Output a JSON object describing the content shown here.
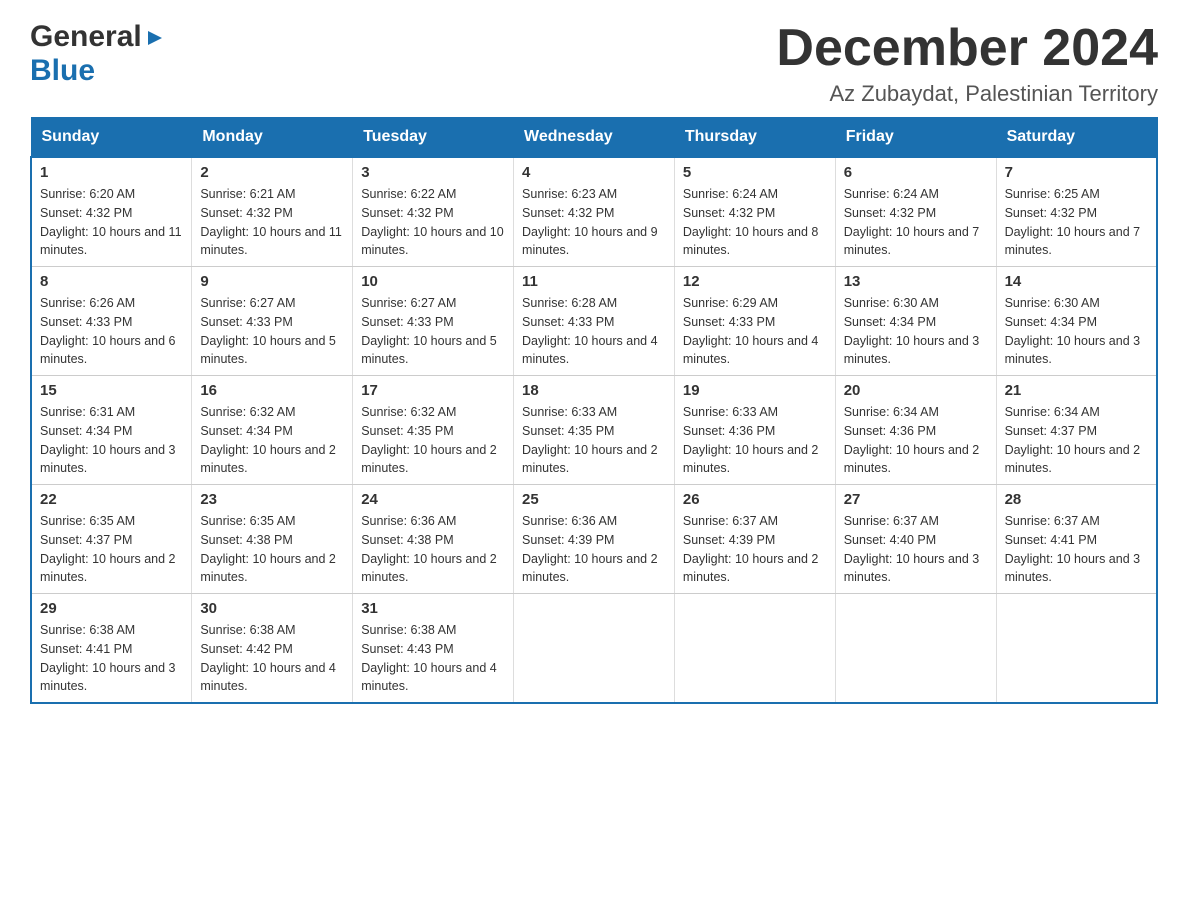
{
  "header": {
    "logo_general": "General",
    "logo_blue": "Blue",
    "month_title": "December 2024",
    "location": "Az Zubaydat, Palestinian Territory"
  },
  "weekdays": [
    "Sunday",
    "Monday",
    "Tuesday",
    "Wednesday",
    "Thursday",
    "Friday",
    "Saturday"
  ],
  "weeks": [
    [
      {
        "day": "1",
        "sunrise": "Sunrise: 6:20 AM",
        "sunset": "Sunset: 4:32 PM",
        "daylight": "Daylight: 10 hours and 11 minutes."
      },
      {
        "day": "2",
        "sunrise": "Sunrise: 6:21 AM",
        "sunset": "Sunset: 4:32 PM",
        "daylight": "Daylight: 10 hours and 11 minutes."
      },
      {
        "day": "3",
        "sunrise": "Sunrise: 6:22 AM",
        "sunset": "Sunset: 4:32 PM",
        "daylight": "Daylight: 10 hours and 10 minutes."
      },
      {
        "day": "4",
        "sunrise": "Sunrise: 6:23 AM",
        "sunset": "Sunset: 4:32 PM",
        "daylight": "Daylight: 10 hours and 9 minutes."
      },
      {
        "day": "5",
        "sunrise": "Sunrise: 6:24 AM",
        "sunset": "Sunset: 4:32 PM",
        "daylight": "Daylight: 10 hours and 8 minutes."
      },
      {
        "day": "6",
        "sunrise": "Sunrise: 6:24 AM",
        "sunset": "Sunset: 4:32 PM",
        "daylight": "Daylight: 10 hours and 7 minutes."
      },
      {
        "day": "7",
        "sunrise": "Sunrise: 6:25 AM",
        "sunset": "Sunset: 4:32 PM",
        "daylight": "Daylight: 10 hours and 7 minutes."
      }
    ],
    [
      {
        "day": "8",
        "sunrise": "Sunrise: 6:26 AM",
        "sunset": "Sunset: 4:33 PM",
        "daylight": "Daylight: 10 hours and 6 minutes."
      },
      {
        "day": "9",
        "sunrise": "Sunrise: 6:27 AM",
        "sunset": "Sunset: 4:33 PM",
        "daylight": "Daylight: 10 hours and 5 minutes."
      },
      {
        "day": "10",
        "sunrise": "Sunrise: 6:27 AM",
        "sunset": "Sunset: 4:33 PM",
        "daylight": "Daylight: 10 hours and 5 minutes."
      },
      {
        "day": "11",
        "sunrise": "Sunrise: 6:28 AM",
        "sunset": "Sunset: 4:33 PM",
        "daylight": "Daylight: 10 hours and 4 minutes."
      },
      {
        "day": "12",
        "sunrise": "Sunrise: 6:29 AM",
        "sunset": "Sunset: 4:33 PM",
        "daylight": "Daylight: 10 hours and 4 minutes."
      },
      {
        "day": "13",
        "sunrise": "Sunrise: 6:30 AM",
        "sunset": "Sunset: 4:34 PM",
        "daylight": "Daylight: 10 hours and 3 minutes."
      },
      {
        "day": "14",
        "sunrise": "Sunrise: 6:30 AM",
        "sunset": "Sunset: 4:34 PM",
        "daylight": "Daylight: 10 hours and 3 minutes."
      }
    ],
    [
      {
        "day": "15",
        "sunrise": "Sunrise: 6:31 AM",
        "sunset": "Sunset: 4:34 PM",
        "daylight": "Daylight: 10 hours and 3 minutes."
      },
      {
        "day": "16",
        "sunrise": "Sunrise: 6:32 AM",
        "sunset": "Sunset: 4:34 PM",
        "daylight": "Daylight: 10 hours and 2 minutes."
      },
      {
        "day": "17",
        "sunrise": "Sunrise: 6:32 AM",
        "sunset": "Sunset: 4:35 PM",
        "daylight": "Daylight: 10 hours and 2 minutes."
      },
      {
        "day": "18",
        "sunrise": "Sunrise: 6:33 AM",
        "sunset": "Sunset: 4:35 PM",
        "daylight": "Daylight: 10 hours and 2 minutes."
      },
      {
        "day": "19",
        "sunrise": "Sunrise: 6:33 AM",
        "sunset": "Sunset: 4:36 PM",
        "daylight": "Daylight: 10 hours and 2 minutes."
      },
      {
        "day": "20",
        "sunrise": "Sunrise: 6:34 AM",
        "sunset": "Sunset: 4:36 PM",
        "daylight": "Daylight: 10 hours and 2 minutes."
      },
      {
        "day": "21",
        "sunrise": "Sunrise: 6:34 AM",
        "sunset": "Sunset: 4:37 PM",
        "daylight": "Daylight: 10 hours and 2 minutes."
      }
    ],
    [
      {
        "day": "22",
        "sunrise": "Sunrise: 6:35 AM",
        "sunset": "Sunset: 4:37 PM",
        "daylight": "Daylight: 10 hours and 2 minutes."
      },
      {
        "day": "23",
        "sunrise": "Sunrise: 6:35 AM",
        "sunset": "Sunset: 4:38 PM",
        "daylight": "Daylight: 10 hours and 2 minutes."
      },
      {
        "day": "24",
        "sunrise": "Sunrise: 6:36 AM",
        "sunset": "Sunset: 4:38 PM",
        "daylight": "Daylight: 10 hours and 2 minutes."
      },
      {
        "day": "25",
        "sunrise": "Sunrise: 6:36 AM",
        "sunset": "Sunset: 4:39 PM",
        "daylight": "Daylight: 10 hours and 2 minutes."
      },
      {
        "day": "26",
        "sunrise": "Sunrise: 6:37 AM",
        "sunset": "Sunset: 4:39 PM",
        "daylight": "Daylight: 10 hours and 2 minutes."
      },
      {
        "day": "27",
        "sunrise": "Sunrise: 6:37 AM",
        "sunset": "Sunset: 4:40 PM",
        "daylight": "Daylight: 10 hours and 3 minutes."
      },
      {
        "day": "28",
        "sunrise": "Sunrise: 6:37 AM",
        "sunset": "Sunset: 4:41 PM",
        "daylight": "Daylight: 10 hours and 3 minutes."
      }
    ],
    [
      {
        "day": "29",
        "sunrise": "Sunrise: 6:38 AM",
        "sunset": "Sunset: 4:41 PM",
        "daylight": "Daylight: 10 hours and 3 minutes."
      },
      {
        "day": "30",
        "sunrise": "Sunrise: 6:38 AM",
        "sunset": "Sunset: 4:42 PM",
        "daylight": "Daylight: 10 hours and 4 minutes."
      },
      {
        "day": "31",
        "sunrise": "Sunrise: 6:38 AM",
        "sunset": "Sunset: 4:43 PM",
        "daylight": "Daylight: 10 hours and 4 minutes."
      },
      {
        "day": "",
        "sunrise": "",
        "sunset": "",
        "daylight": ""
      },
      {
        "day": "",
        "sunrise": "",
        "sunset": "",
        "daylight": ""
      },
      {
        "day": "",
        "sunrise": "",
        "sunset": "",
        "daylight": ""
      },
      {
        "day": "",
        "sunrise": "",
        "sunset": "",
        "daylight": ""
      }
    ]
  ]
}
